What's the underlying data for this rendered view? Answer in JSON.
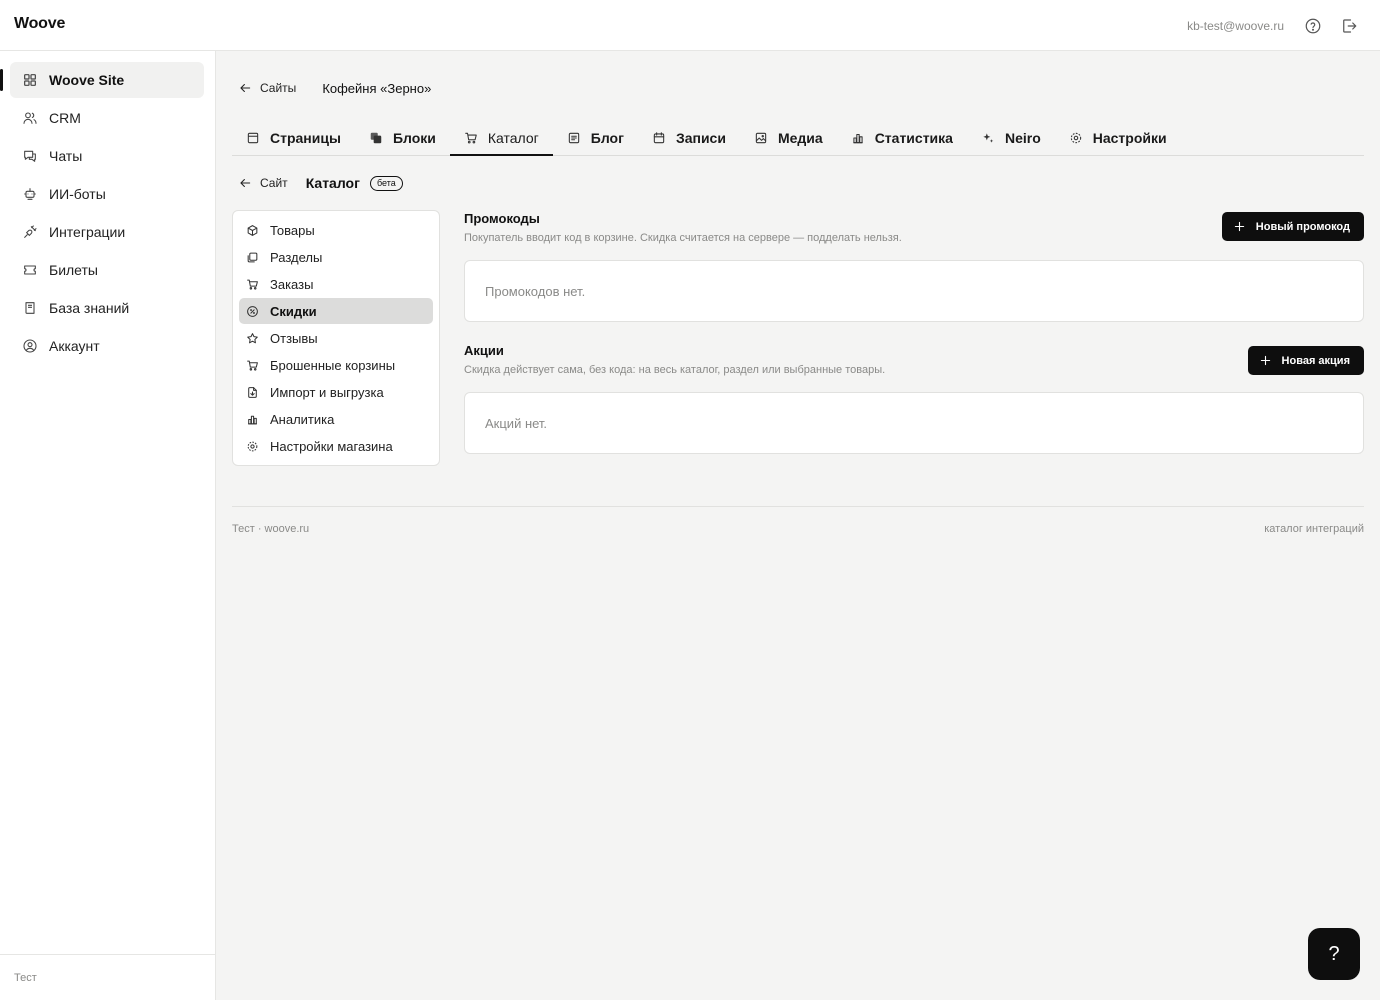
{
  "header": {
    "brand": "Woove",
    "user_email": "kb-test@woove.ru"
  },
  "sidebar": {
    "items": [
      {
        "label": "Woove Site",
        "icon": "grid-icon",
        "active": true
      },
      {
        "label": "CRM",
        "icon": "users-icon"
      },
      {
        "label": "Чаты",
        "icon": "chat-icon"
      },
      {
        "label": "ИИ-боты",
        "icon": "bot-icon"
      },
      {
        "label": "Интеграции",
        "icon": "plug-icon"
      },
      {
        "label": "Билеты",
        "icon": "ticket-icon"
      },
      {
        "label": "База знаний",
        "icon": "book-icon"
      },
      {
        "label": "Аккаунт",
        "icon": "account-icon"
      }
    ],
    "footer": "Тест"
  },
  "breadcrumb": {
    "back_label": "Сайты",
    "site_name": "Кофейня «Зерно»"
  },
  "tabs": [
    {
      "label": "Страницы",
      "icon": "pages-icon"
    },
    {
      "label": "Блоки",
      "icon": "blocks-icon"
    },
    {
      "label": "Каталог",
      "icon": "cart-icon",
      "active": true
    },
    {
      "label": "Блог",
      "icon": "blog-icon"
    },
    {
      "label": "Записи",
      "icon": "calendar-icon"
    },
    {
      "label": "Медиа",
      "icon": "image-icon"
    },
    {
      "label": "Статистика",
      "icon": "stats-icon"
    },
    {
      "label": "Neiro",
      "icon": "sparkle-icon"
    },
    {
      "label": "Настройки",
      "icon": "gear-icon"
    }
  ],
  "subheader": {
    "back_label": "Сайт",
    "title": "Каталог",
    "badge": "бета"
  },
  "catalog_menu": [
    {
      "label": "Товары",
      "icon": "box-icon"
    },
    {
      "label": "Разделы",
      "icon": "folders-icon"
    },
    {
      "label": "Заказы",
      "icon": "cart-icon"
    },
    {
      "label": "Скидки",
      "icon": "discount-icon",
      "active": true
    },
    {
      "label": "Отзывы",
      "icon": "star-icon"
    },
    {
      "label": "Брошенные корзины",
      "icon": "abandoned-cart-icon"
    },
    {
      "label": "Импорт и выгрузка",
      "icon": "file-transfer-icon"
    },
    {
      "label": "Аналитика",
      "icon": "stats-icon"
    },
    {
      "label": "Настройки магазина",
      "icon": "gear-icon"
    }
  ],
  "promocodes": {
    "title": "Промокоды",
    "description": "Покупатель вводит код в корзине. Скидка считается на сервере — подделать нельзя.",
    "button": "Новый промокод",
    "empty": "Промокодов нет."
  },
  "actions": {
    "title": "Акции",
    "description": "Скидка действует сама, без кода: на весь каталог, раздел или выбранные товары.",
    "button": "Новая акция",
    "empty": "Акций нет."
  },
  "footer": {
    "left": "Тест · woove.ru",
    "right": "каталог интеграций"
  },
  "help_button": "?"
}
